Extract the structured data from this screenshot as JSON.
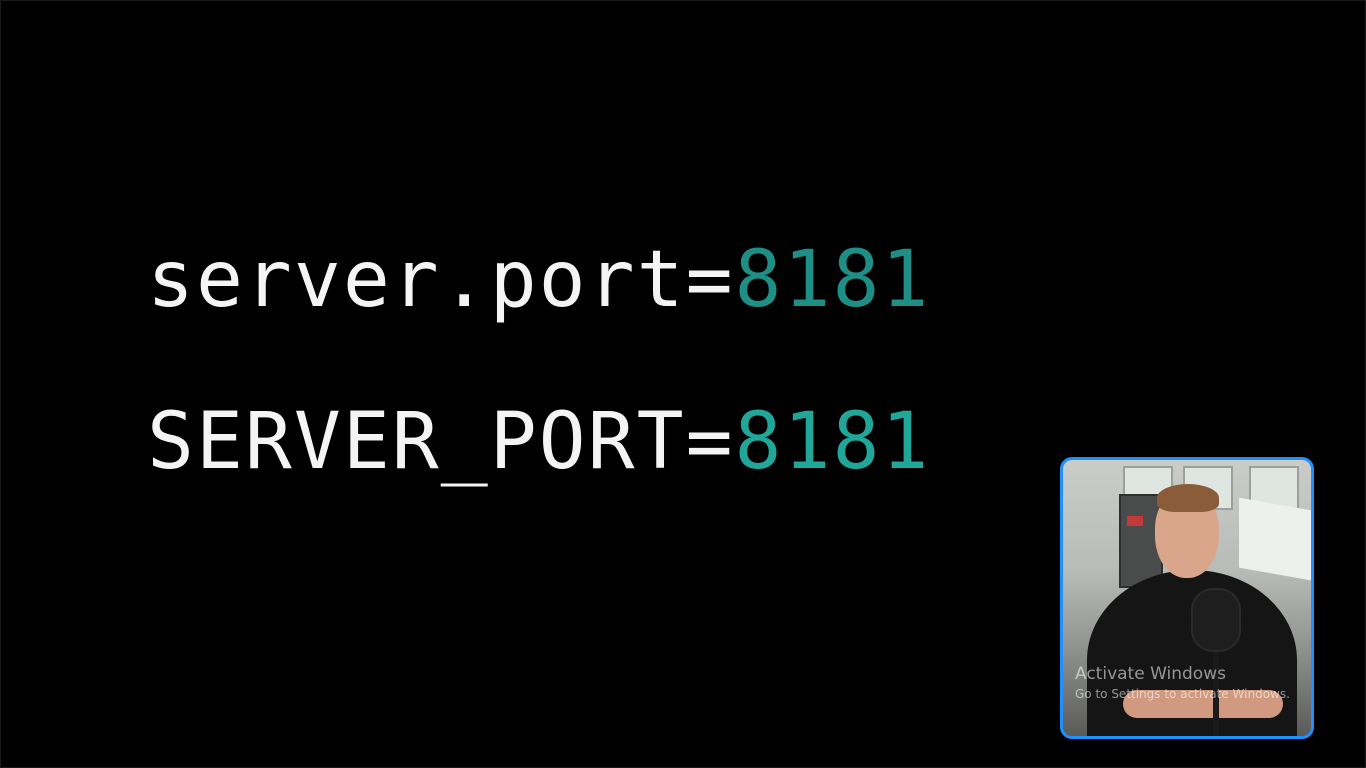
{
  "code": {
    "line1": {
      "key": "server.port",
      "equals": "=",
      "value": "8181"
    },
    "line2": {
      "key": "SERVER_PORT",
      "equals": "=",
      "value": "8181"
    }
  },
  "colors": {
    "background": "#000000",
    "text": "#f4f4f4",
    "value_accent_1": "#1e8f86",
    "value_accent_2": "#21a79a",
    "webcam_border": "#1e90ff"
  },
  "webcam": {
    "watermark_title": "Activate Windows",
    "watermark_subtitle": "Go to Settings to activate Windows."
  }
}
